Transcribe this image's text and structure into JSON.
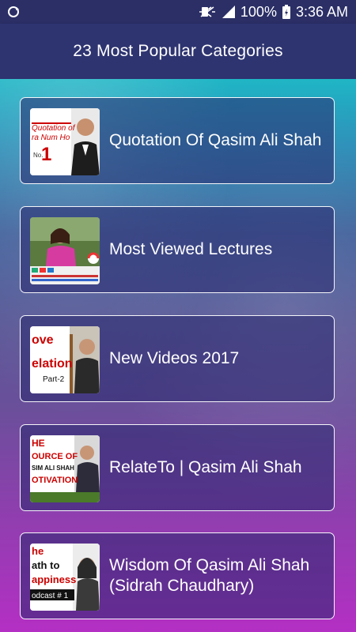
{
  "status_bar": {
    "battery": "100%",
    "time": "3:36 AM",
    "icons": [
      "sync-icon",
      "mute-icon",
      "signal-icon",
      "battery-charging-icon"
    ]
  },
  "app_bar": {
    "title": "23 Most Popular Categories"
  },
  "categories": [
    {
      "label": "Quotation Of Qasim Ali Shah",
      "thumb_text": "Quotation of\nra Num Ho\n1"
    },
    {
      "label": "Most Viewed Lectures",
      "thumb_text": ""
    },
    {
      "label": "New Videos 2017",
      "thumb_text": "ove\nelation\nPart-2"
    },
    {
      "label": "RelateTo | Qasim Ali Shah",
      "thumb_text": "HE\nOURCE OF\nSIM ALI SHAH\nOTIVATION"
    },
    {
      "label": "Wisdom Of Qasim Ali Shah (Sidrah Chaudhary)",
      "thumb_text": "he\nath to\nappiness\nodcast # 1"
    }
  ]
}
